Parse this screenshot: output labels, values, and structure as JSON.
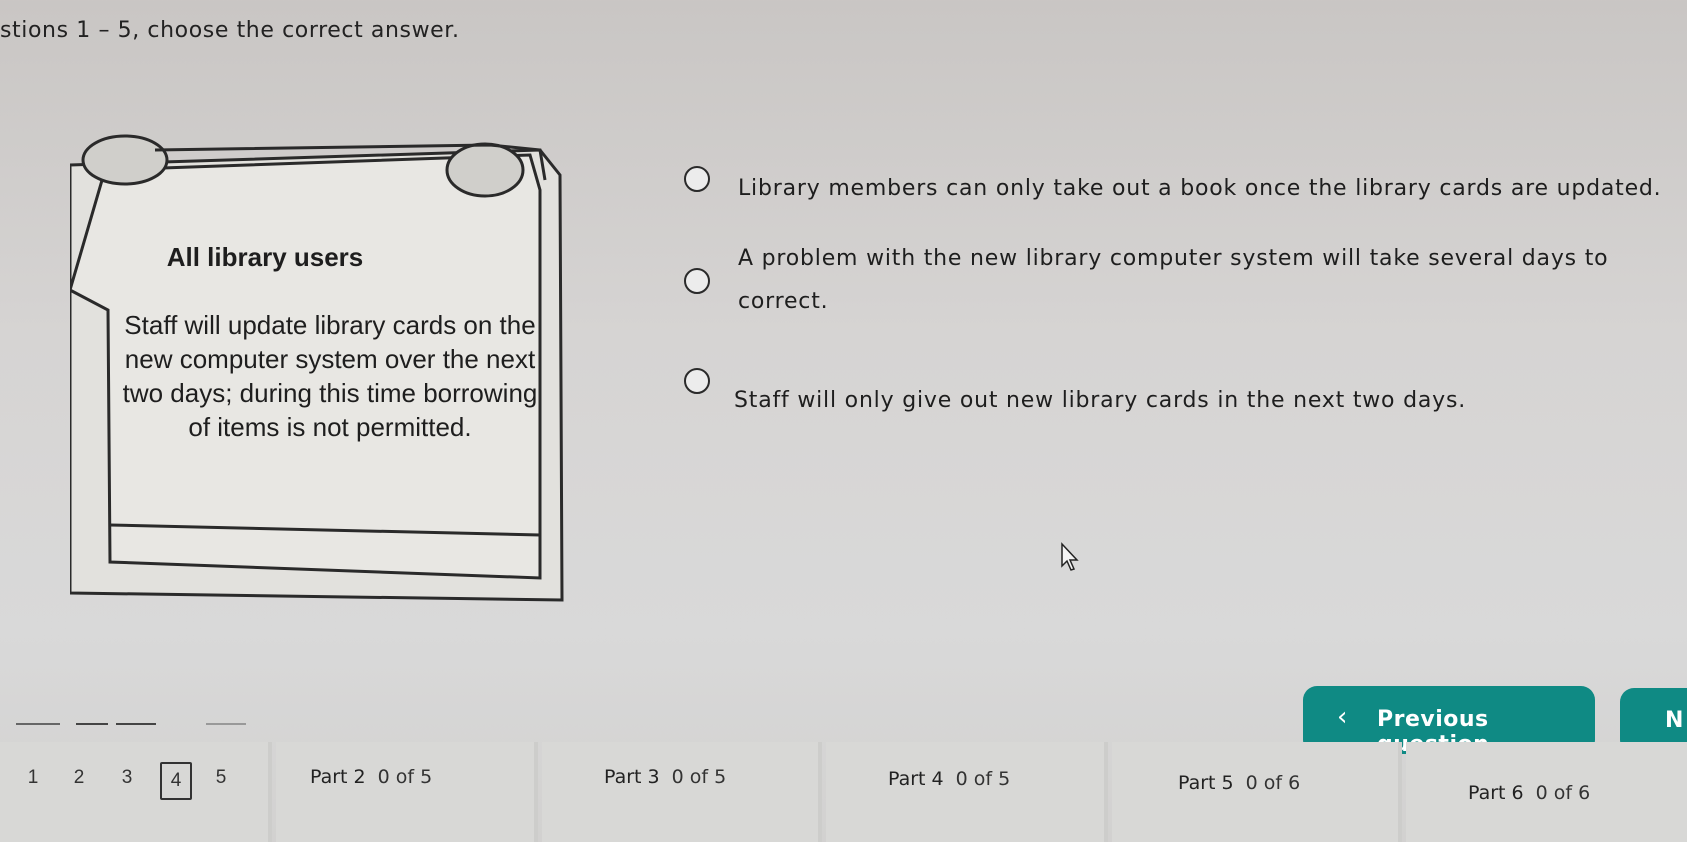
{
  "instructions": "stions 1 – 5, choose the correct answer.",
  "notice": {
    "title": "All library users",
    "body": "Staff will update library cards on the new computer system over the next two days; during this time borrowing of items is not permitted."
  },
  "options": [
    "Library members can only take out a book once the library cards are updated.",
    "A problem with the new library computer system will take several days to",
    "correct.",
    "Staff will only give out new library cards in the next two days."
  ],
  "buttons": {
    "previous": "Previous question",
    "next": "N"
  },
  "footer": {
    "question_numbers": [
      "1",
      "2",
      "3",
      "4",
      "5"
    ],
    "current_question": "4",
    "parts": [
      {
        "label": "Part 2",
        "count": "0 of 5"
      },
      {
        "label": "Part 3",
        "count": "0 of 5"
      },
      {
        "label": "Part 4",
        "count": "0 of 5"
      },
      {
        "label": "Part 5",
        "count": "0 of 6"
      },
      {
        "label": "Part 6",
        "count": "0 of 6"
      }
    ]
  },
  "colors": {
    "accent": "#0f8a84",
    "background": "#d6d6d5",
    "text": "#1e1e1e"
  }
}
